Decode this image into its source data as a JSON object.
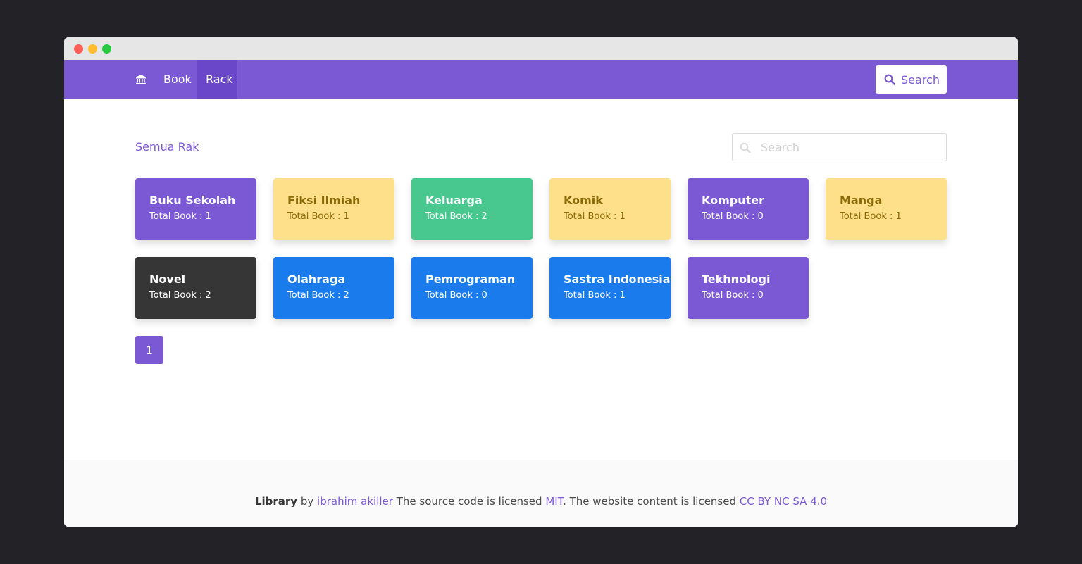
{
  "navbar": {
    "home_icon": "bank-icon",
    "items": [
      {
        "label": "Book"
      },
      {
        "label": "Rack"
      }
    ],
    "search_button": {
      "label": "Search",
      "icon": "search-icon"
    }
  },
  "main": {
    "title": "Semua Rak",
    "search": {
      "placeholder": "Search",
      "value": ""
    },
    "racks": [
      {
        "name": "Buku Sekolah",
        "count": "Total Book : 1",
        "color": "#7b59d4"
      },
      {
        "name": "Fiksi Ilmiah",
        "count": "Total Book : 1",
        "color": "#ffe08a"
      },
      {
        "name": "Keluarga",
        "count": "Total Book : 2",
        "color": "#48c78e"
      },
      {
        "name": "Komik",
        "count": "Total Book : 1",
        "color": "#ffe08a"
      },
      {
        "name": "Komputer",
        "count": "Total Book : 0",
        "color": "#7b59d4"
      },
      {
        "name": "Manga",
        "count": "Total Book : 1",
        "color": "#ffe08a"
      },
      {
        "name": "Novel",
        "count": "Total Book : 2",
        "color": "#363636"
      },
      {
        "name": "Olahraga",
        "count": "Total Book : 2",
        "color": "#1a7cec"
      },
      {
        "name": "Pemrograman",
        "count": "Total Book : 0",
        "color": "#1a7cec"
      },
      {
        "name": "Sastra Indonesia",
        "count": "Total Book : 1",
        "color": "#1a7cec"
      },
      {
        "name": "Tekhnologi",
        "count": "Total Book : 0",
        "color": "#7b59d4"
      }
    ],
    "pagination": {
      "current": "1"
    }
  },
  "footer": {
    "brand": "Library",
    "by": "by",
    "author": "ibrahim akiller",
    "text1": "The source code is licensed",
    "license": "MIT",
    "text2": ". The website content is licensed",
    "content_license": "CC BY NC SA 4.0"
  }
}
